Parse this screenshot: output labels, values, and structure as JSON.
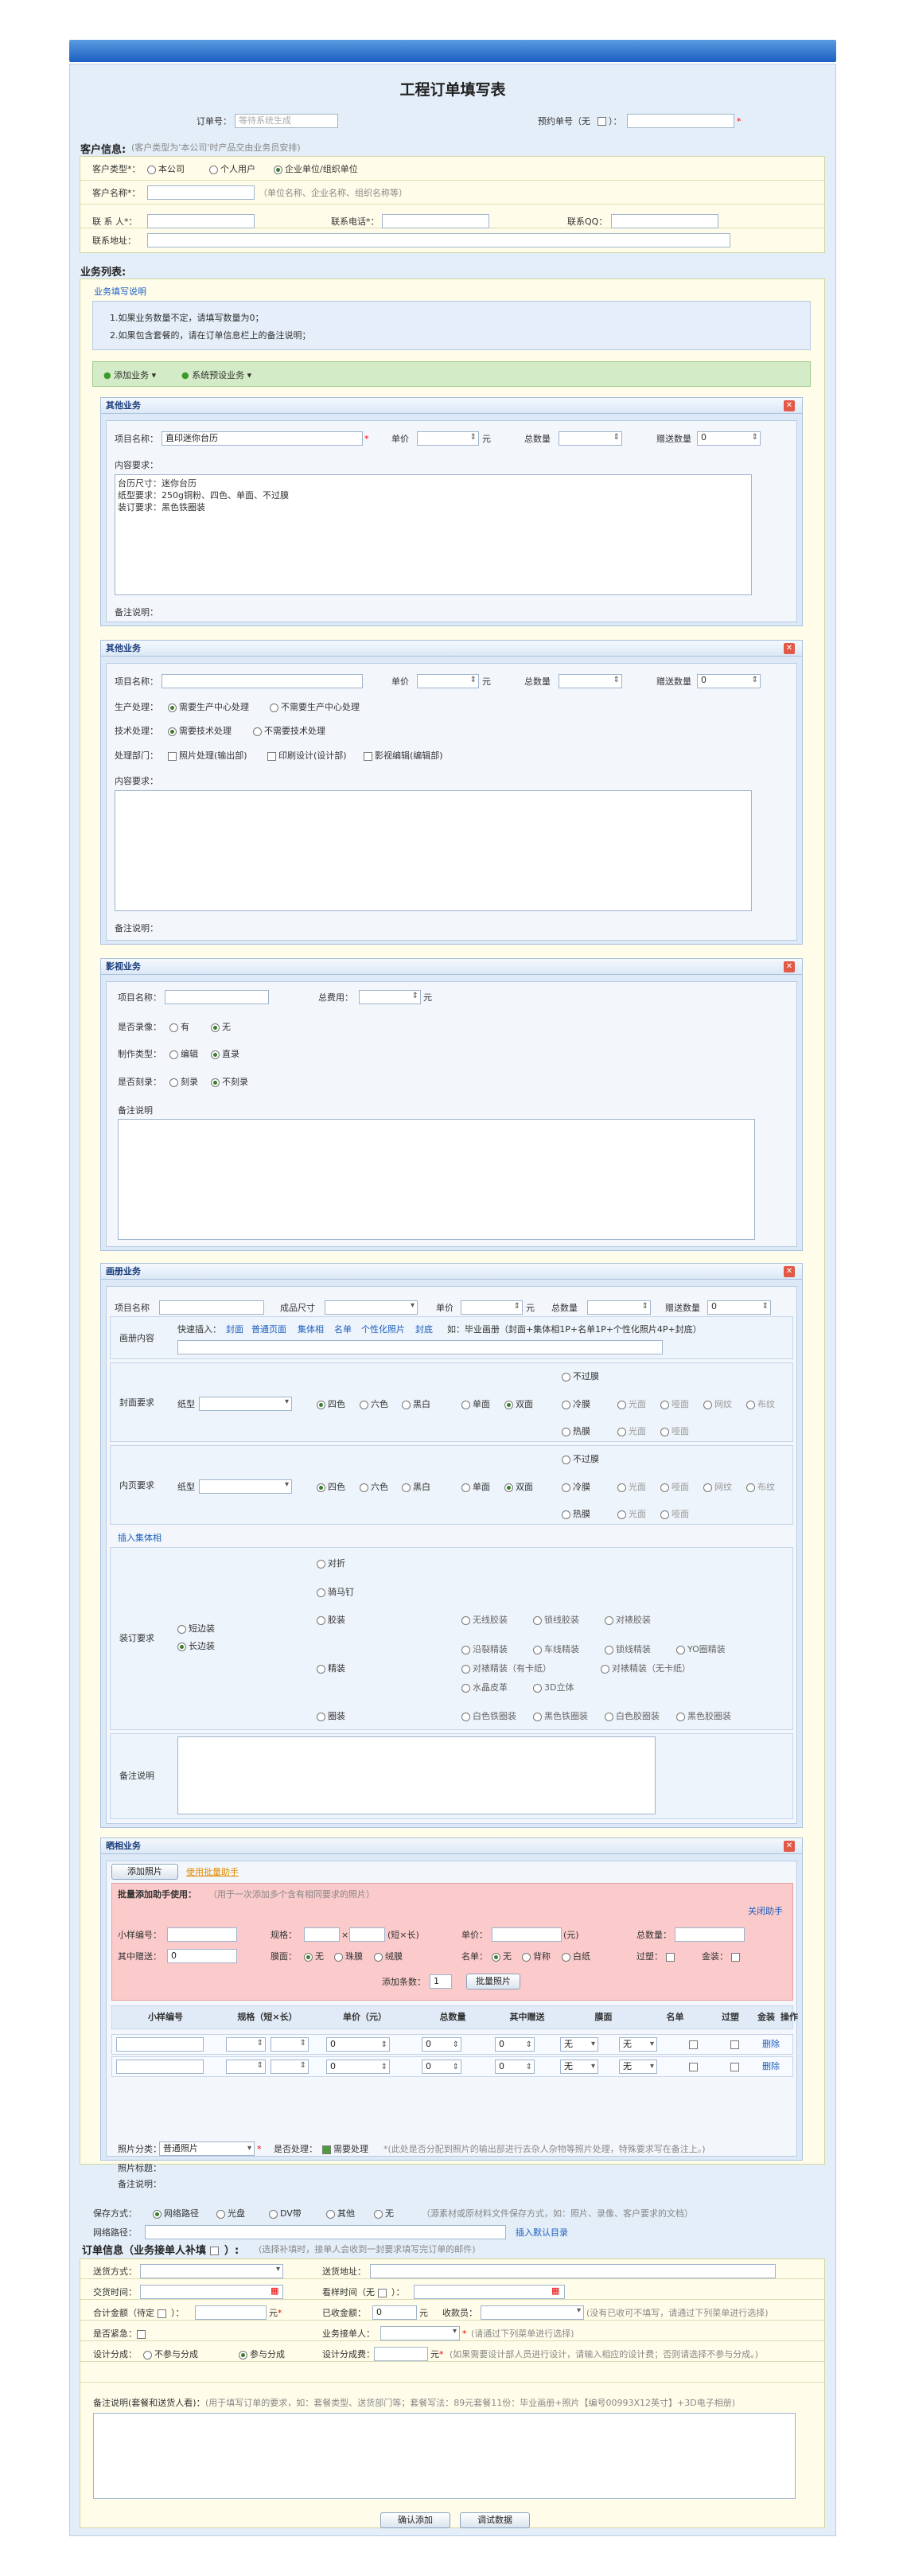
{
  "title": "工程订单填写表",
  "order": {
    "no_label": "订单号：",
    "no_placeholder": "等待系统生成",
    "pre_label": "预约单号（无 ",
    "pre_label2": " ）："
  },
  "customer": {
    "head": "客户信息:",
    "head_hint": "(客户类型为'本公司'时产品交由业务员安排)",
    "type_label": "客户类型*：",
    "types": [
      "本公司",
      "个人用户",
      "企业单位/组织单位"
    ],
    "name_label": "客户名称*：",
    "name_hint": "（单位名称、企业名称、组织名称等）",
    "contact_label": "联 系 人*：",
    "phone_label": "联系电话*：",
    "qq_label": "联系QQ：",
    "addr_label": "联系地址："
  },
  "business": {
    "head": "业务列表:",
    "guide_link": "业务填写说明",
    "guide1": "1.如果业务数量不定，请填写数量为0；",
    "guide2": "2.如果包含套餐的，请在订单信息栏上的备注说明；",
    "add_btn": "添加业务",
    "sys_btn": "系统预设业务"
  },
  "other1": {
    "title": "其他业务",
    "name_label": "项目名称：",
    "name_value": "直印迷你台历",
    "price_label": "单价",
    "unit": "元",
    "total_label": "总数量",
    "gift_label": "赠送数量",
    "gift_value": "0",
    "content_label": "内容要求：",
    "content_lines": [
      "台历尺寸：迷你台历",
      "纸型要求：250g铜粉、四色、单面、不过膜",
      "装订要求：黑色铁圈装"
    ],
    "remark_label": "备注说明："
  },
  "other2": {
    "title": "其他业务",
    "name_label": "项目名称：",
    "price_label": "单价",
    "unit": "元",
    "total_label": "总数量",
    "gift_label": "赠送数量",
    "gift_value": "0",
    "prod_label": "生产处理：",
    "prod_opts": [
      "需要生产中心处理",
      "不需要生产中心处理"
    ],
    "tech_label": "技术处理：",
    "tech_opts": [
      "需要技术处理",
      "不需要技术处理"
    ],
    "dept_label": "处理部门：",
    "dept_opts": [
      "照片处理(输出部)",
      "印刷设计(设计部)",
      "影视编辑(编辑部)"
    ],
    "content_label": "内容要求：",
    "remark_label": "备注说明："
  },
  "video": {
    "title": "影视业务",
    "name_label": "项目名称：",
    "cost_label": "总费用：",
    "unit": "元",
    "record_label": "是否录像：",
    "record_opts": [
      "有",
      "无"
    ],
    "make_label": "制作类型：",
    "make_opts": [
      "编辑",
      "直录"
    ],
    "burn_label": "是否刻录：",
    "burn_opts": [
      "刻录",
      "不刻录"
    ],
    "remark_label": "备注说明"
  },
  "album": {
    "title": "画册业务",
    "name_label": "项目名称",
    "size_label": "成品尺寸",
    "price_label": "单价",
    "unit": "元",
    "total_label": "总数量",
    "gift_label": "赠送数量",
    "gift_value": "0",
    "content_label": "画册内容",
    "quick_label": "快速插入：",
    "quick_links": [
      "封面",
      "普通页面",
      "集体相",
      "名单",
      "个性化照片",
      "封底"
    ],
    "quick_hint": "如：毕业画册（封面+集体相1P+名单1P+个性化照片4P+封底）",
    "cover_label": "封面要求",
    "inner_label": "内页要求",
    "paper_label": "纸型",
    "colors": [
      "四色",
      "六色",
      "黑白"
    ],
    "sides": [
      "单面",
      "双面"
    ],
    "film": [
      "不过膜",
      "冷膜",
      "热膜"
    ],
    "film_opts": [
      "光面",
      "哑面",
      "网纹",
      "布纹"
    ],
    "insert_link": "插入集体相",
    "bind_label": "装订要求",
    "bind_dir": [
      "短边装",
      "长边装"
    ],
    "bind_types": [
      "对折",
      "骑马钉",
      "胶装",
      "精装",
      "圈装"
    ],
    "glue": [
      "无线胶装",
      "锁线胶装",
      "对裱胶装"
    ],
    "hard": [
      "沿裂精装",
      "车线精装",
      "锁线精装",
      "YO圈精装",
      "对裱精装（有卡纸）",
      "对裱精装（无卡纸）",
      "水晶皮革",
      "3D立体"
    ],
    "ring": [
      "白色铁圈装",
      "黑色铁圈装",
      "白色胶圈装",
      "黑色胶圈装"
    ],
    "remark_label": "备注说明"
  },
  "photo": {
    "title": "晒相业务",
    "add_btn": "添加照片",
    "bulk_link": "使用批量助手",
    "bulk_title": "批量添加助手使用：",
    "bulk_hint": "（用于一次添加多个含有相同要求的照片）",
    "close": "关闭助手",
    "lbl_small": "小样编号：",
    "lbl_spec": "规格：",
    "spec_hint": "(短×长)",
    "lbl_price": "单价：",
    "price_unit": "(元)",
    "lbl_total": "总数量：",
    "lbl_gift": "其中赠送：",
    "gift_value": "0",
    "lbl_film": "膜面：",
    "film_opts": [
      "无",
      "珠膜",
      "绒膜"
    ],
    "lbl_name": "名单：",
    "name_opts": [
      "无",
      "背称",
      "白纸"
    ],
    "lbl_over": "过塑：",
    "lbl_gold": "金装：",
    "count_label": "添加条数：",
    "count_value": "1",
    "bulk_btn": "批量照片",
    "cols": [
      "小样编号",
      "规格（短×长）",
      "单价（元）",
      "总数量",
      "其中赠送",
      "膜面",
      "名单",
      "过塑",
      "金装",
      "操作"
    ],
    "rows": [
      {
        "price": "0",
        "total": "0",
        "gift": "0",
        "film": "无",
        "name": "无",
        "op": "删除"
      },
      {
        "price": "0",
        "total": "0",
        "gift": "0",
        "film": "无",
        "name": "无",
        "op": "删除"
      }
    ],
    "cat_label": "照片分类：",
    "cat_value": "普通照片",
    "proc_label": "是否处理：",
    "proc_value": "需要处理",
    "proc_hint": "*(此处是否分配到照片的输出部进行去杂人杂物等照片处理，特殊要求写在备注上。)",
    "title_label": "照片标题：",
    "remark_label": "备注说明："
  },
  "save": {
    "label": "保存方式：",
    "opts": [
      "网络路径",
      "光盘",
      "DV带",
      "其他",
      "无"
    ],
    "hint": "（源素材或原材料文件保存方式，如：照片、录像、客户要求的文档）",
    "path_label": "网络路径：",
    "path_link": "插入默认目录"
  },
  "orderinfo": {
    "head": "订单信息（业务接单人补填 ",
    "head2": " ）:",
    "head_hint": "(选择补填时，接单人会收到一封要求填写完订单的邮件)",
    "deliver_label": "送货方式：",
    "addr_label": "送货地址：",
    "time_label": "交货时间：",
    "visit_label": "看样时间（无 ",
    "visit_label2": " ）：",
    "acc_label": "合计金额（待定 ",
    "acc_label2": " ）：",
    "unit": "元",
    "paid_label": "已收金额：",
    "paid_value": "0",
    "collector_label": "收款员：",
    "collector_hint": "(没有已收可不填写，请通过下列菜单进行选择)",
    "urgent_label": "是否紧急：",
    "taker_label": "业务接单人：",
    "taker_hint": "(请通过下列菜单进行选择)",
    "design_label": "设计分成：",
    "design_opts": [
      "不参与分成",
      "参与分成"
    ],
    "fee_label": "设计分成费：",
    "fee_hint": "(如果需要设计部人员进行设计，请输入相应的设计费；否则请选择不参与分成。)",
    "remark_label": "备注说明(套餐和送货人看)：",
    "remark_hint": "(用于填写订单的要求，如：套餐类型、送货部门等；套餐写法：89元套餐11份：毕业画册+照片【编号00993X12英寸】+3D电子相册)"
  },
  "buttons": {
    "confirm": "确认添加",
    "debug": "调试数据"
  }
}
